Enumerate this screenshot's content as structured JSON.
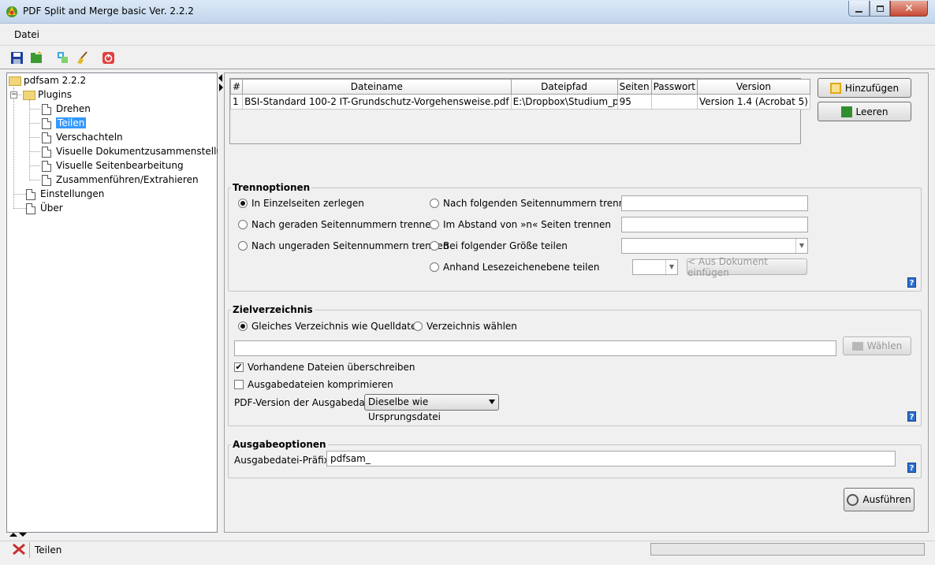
{
  "window": {
    "title": "PDF Split and Merge basic Ver. 2.2.2"
  },
  "menu": {
    "datei": "Datei"
  },
  "toolbar": [
    "save-icon",
    "open-icon",
    "tree-icon",
    "clean-icon",
    "power-icon"
  ],
  "tree": {
    "root": "pdfsam 2.2.2",
    "plugins": "Plugins",
    "items": [
      "Drehen",
      "Teilen",
      "Verschachteln",
      "Visuelle Dokumentzusammenstellung",
      "Visuelle Seitenbearbeitung",
      "Zusammenführen/Extrahieren"
    ],
    "selected": "Teilen",
    "settings": "Einstellungen",
    "about": "Über"
  },
  "table": {
    "headers": [
      "#",
      "Dateiname",
      "Dateipfad",
      "Seiten",
      "Passwort",
      "Version"
    ],
    "rows": [
      [
        "1",
        "BSI-Standard 100-2 IT-Grundschutz-Vorgehensweise.pdf",
        "E:\\Dropbox\\Studium_p...",
        "95",
        "",
        "Version 1.4 (Acrobat 5)"
      ]
    ]
  },
  "buttons": {
    "add": "Hinzufügen",
    "clear": "Leeren",
    "choose": "Wählen",
    "run": "Ausführen",
    "insert_doc": "< Aus Dokument einfügen"
  },
  "split": {
    "title": "Trennoptionen",
    "single": "In Einzelseiten zerlegen",
    "even": "Nach geraden Seitennummern trennen",
    "odd": "Nach ungeraden Seitennummern trennen",
    "after_pages": "Nach folgenden Seitennummern trennen",
    "every_n": "Im Abstand von »n« Seiten trennen",
    "by_size": "Bei folgender Größe teilen",
    "by_bookmark": "Anhand Lesezeichenebene teilen"
  },
  "dest": {
    "title": "Zielverzeichnis",
    "same_dir": "Gleiches Verzeichnis wie Quelldatei",
    "choose_dir": "Verzeichnis wählen",
    "overwrite": "Vorhandene Dateien überschreiben",
    "compress": "Ausgabedateien komprimieren",
    "pdf_version_label": "PDF-Version der Ausgabedatei:",
    "pdf_version_value": "Dieselbe wie Ursprungsdatei"
  },
  "output": {
    "title": "Ausgabeoptionen",
    "prefix_label": "Ausgabedatei-Präfix:",
    "prefix_value": "pdfsam_"
  },
  "status": {
    "text": "Teilen"
  }
}
